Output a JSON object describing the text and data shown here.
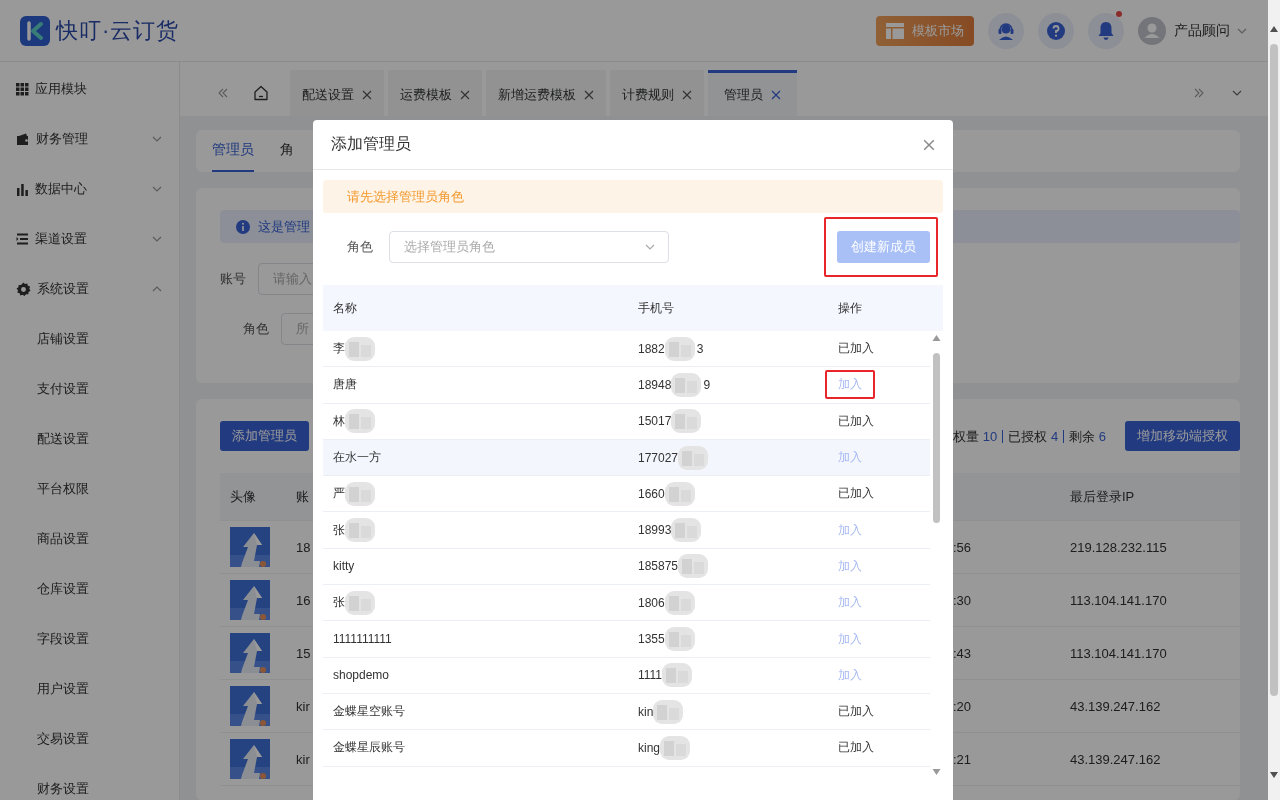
{
  "header": {
    "logo_text": "快叮·云订货",
    "market_button": "模板市场",
    "notification_dot": true,
    "user": "产品顾问"
  },
  "sidebar": {
    "items": [
      {
        "label": "应用模块"
      },
      {
        "label": "财务管理",
        "expanded": false
      },
      {
        "label": "数据中心",
        "expanded": false
      },
      {
        "label": "渠道设置",
        "expanded": false
      },
      {
        "label": "系统设置",
        "expanded": true,
        "children": [
          {
            "label": "店铺设置"
          },
          {
            "label": "支付设置"
          },
          {
            "label": "配送设置"
          },
          {
            "label": "平台权限"
          },
          {
            "label": "商品设置"
          },
          {
            "label": "仓库设置"
          },
          {
            "label": "字段设置"
          },
          {
            "label": "用户设置"
          },
          {
            "label": "交易设置"
          },
          {
            "label": "财务设置"
          }
        ]
      }
    ]
  },
  "tabs": [
    {
      "label": "配送设置",
      "selected": false
    },
    {
      "label": "运费模板",
      "selected": false
    },
    {
      "label": "新增运费模板",
      "selected": false
    },
    {
      "label": "计费规则",
      "selected": false
    },
    {
      "label": "管理员",
      "selected": true
    }
  ],
  "page": {
    "subtabs": [
      {
        "label": "管理员",
        "selected": true
      },
      {
        "label": "角",
        "selected": false
      }
    ],
    "notice": "这是管理",
    "filters": [
      {
        "label": "账号",
        "placeholder": "请输入"
      },
      {
        "label": "角色",
        "placeholder": "所"
      }
    ],
    "add_button": "添加管理员",
    "quota": [
      {
        "label": "权量",
        "value": "10"
      },
      {
        "label": "已授权",
        "value": "4"
      },
      {
        "label": "剩余",
        "value": "6"
      }
    ],
    "auth_button": "增加移动端授权",
    "table": {
      "columns": [
        "头像",
        "账",
        "最后登录IP"
      ],
      "rows": [
        {
          "account": "18",
          "time": ":56",
          "ip": "219.128.232.115"
        },
        {
          "account": "16",
          "time": ":30",
          "ip": "113.104.141.170"
        },
        {
          "account": "15",
          "time": ":43",
          "ip": "113.104.141.170"
        },
        {
          "account": "kir",
          "time": ":20",
          "ip": "43.139.247.162"
        },
        {
          "account": "kir",
          "time": ":21",
          "ip": "43.139.247.162"
        }
      ]
    }
  },
  "modal": {
    "title": "添加管理员",
    "alert": "请先选择管理员角色",
    "role_label": "角色",
    "role_placeholder": "选择管理员角色",
    "create_button": {
      "label": "创建新成员",
      "disabled": true,
      "highlighted": true
    },
    "columns": [
      "名称",
      "手机号",
      "操作"
    ],
    "rows": [
      {
        "name": "李",
        "name_redacted": true,
        "phone": "1882",
        "phone_end": "3",
        "action": "已加入",
        "joined": true,
        "hovered": false,
        "highlighted": false
      },
      {
        "name": "唐唐",
        "name_redacted": false,
        "phone": "18948",
        "phone_end": "9",
        "action": "加入",
        "joined": false,
        "hovered": false,
        "highlighted": true
      },
      {
        "name": "林",
        "name_redacted": true,
        "phone": "15017",
        "action": "已加入",
        "joined": true,
        "hovered": false,
        "highlighted": false
      },
      {
        "name": "在水一方",
        "name_redacted": false,
        "phone": "177027",
        "action": "加入",
        "joined": false,
        "hovered": true,
        "highlighted": false
      },
      {
        "name": "严",
        "name_redacted": true,
        "phone": "1660",
        "action": "已加入",
        "joined": true,
        "hovered": false,
        "highlighted": false
      },
      {
        "name": "张",
        "name_redacted": true,
        "phone": "18993",
        "action": "加入",
        "joined": false,
        "hovered": false,
        "highlighted": false
      },
      {
        "name": "kitty",
        "name_redacted": false,
        "phone": "185875",
        "action": "加入",
        "joined": false,
        "hovered": false,
        "highlighted": false
      },
      {
        "name": "张",
        "name_redacted": true,
        "phone": "1806",
        "action": "加入",
        "joined": false,
        "hovered": false,
        "highlighted": false
      },
      {
        "name": "1111111111",
        "name_redacted": false,
        "phone": "1355",
        "action": "加入",
        "joined": false,
        "hovered": false,
        "highlighted": false
      },
      {
        "name": "shopdemo",
        "name_redacted": false,
        "phone": "1111",
        "action": "加入",
        "joined": false,
        "hovered": false,
        "highlighted": false
      },
      {
        "name": "金蝶星空账号",
        "name_redacted": false,
        "phone": "kin",
        "action": "已加入",
        "joined": true,
        "hovered": false,
        "highlighted": false
      },
      {
        "name": "金蝶星辰账号",
        "name_redacted": false,
        "phone": "king",
        "action": "已加入",
        "joined": true,
        "hovered": false,
        "highlighted": false
      }
    ]
  }
}
